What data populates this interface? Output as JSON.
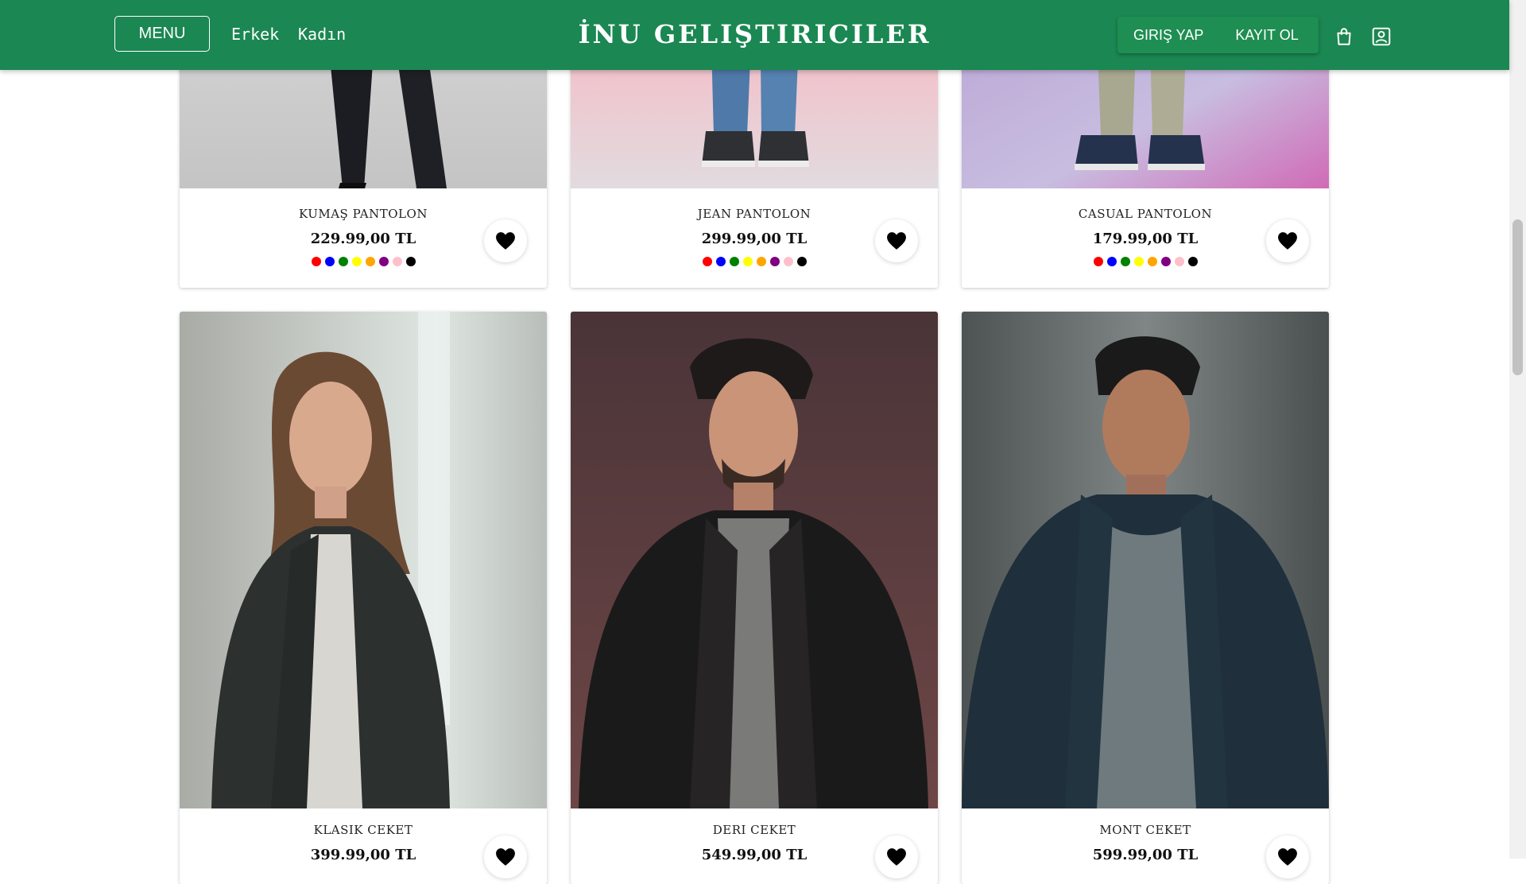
{
  "header": {
    "menu_label": "MENU",
    "nav": [
      "Erkek",
      "Kadın"
    ],
    "brand": "İNU GELIŞTIRICILER",
    "login_label": "GIRIŞ YAP",
    "register_label": "KAYIT OL",
    "icons": [
      "shopping-bag-icon",
      "user-profile-icon"
    ],
    "background_color": "#1b8752"
  },
  "swatch_colors": [
    "#ff0000",
    "#0000ff",
    "#008000",
    "#ffff00",
    "#ffa500",
    "#800080",
    "#ffc0cb",
    "#000000"
  ],
  "products": [
    {
      "name": "KUMAŞ PANTOLON",
      "price": "229.99,00 TL",
      "image": "man in black trousers and shoes"
    },
    {
      "name": "JEAN PANTOLON",
      "price": "299.99,00 TL",
      "image": "blue jeans and canvas sneakers"
    },
    {
      "name": "CASUAL PANTOLON",
      "price": "179.99,00 TL",
      "image": "khaki trousers and navy sneakers"
    },
    {
      "name": "KLASIK CEKET",
      "price": "399.99,00 TL",
      "image": "woman in black coat and grey sweater"
    },
    {
      "name": "DERI CEKET",
      "price": "549.99,00 TL",
      "image": "man in black leather jacket"
    },
    {
      "name": "MONT CEKET",
      "price": "599.99,00 TL",
      "image": "man in dark navy jacket"
    }
  ]
}
